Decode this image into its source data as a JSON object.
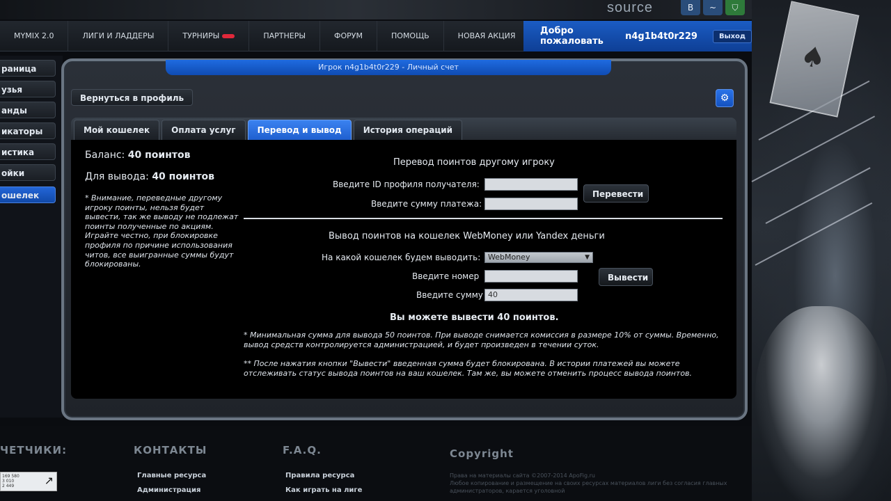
{
  "brand": {
    "text": "source",
    "social": [
      "vk",
      "twitter",
      "shield"
    ]
  },
  "navbar": {
    "items": [
      "MYMIX 2.0",
      "ЛИГИ И ЛАДДЕРЫ",
      "ТУРНИРЫ",
      "ПАРТНЕРЫ",
      "ФОРУМ",
      "ПОМОЩЬ",
      "НОВАЯ АКЦИЯ"
    ],
    "welcome": "Добро пожаловать",
    "username": "n4g1b4t0r229",
    "logout": "Выход"
  },
  "sidebar": {
    "items": [
      "раница",
      "узья",
      "анды",
      "икаторы",
      "истика",
      "ойки",
      "ошелек"
    ],
    "active_index": 6
  },
  "panel": {
    "title": "Игрок n4g1b4t0r229 - Личный счет",
    "back_label": "Вернуться в профиль",
    "gear_icon": "gear-icon",
    "tabs": [
      "Мой кошелек",
      "Оплата услуг",
      "Перевод и вывод",
      "История операций"
    ],
    "active_tab": 2
  },
  "balance": {
    "balance_label": "Баланс:",
    "balance_value": "40 поинтов",
    "withdraw_label": "Для вывода:",
    "withdraw_value": "40 поинтов",
    "note": "* Внимание, переведные другому игроку поинты, нельзя будет вывести, так же выводу не подлежат поинты полученные по акциям.\nИграйте честно, при блокировке профиля по причине использования читов, все выигранные суммы будут блокированы."
  },
  "transfer": {
    "heading": "Перевод поинтов другому игроку",
    "recipient_label": "Введите ID профиля получателя:",
    "recipient_value": "",
    "amount_label": "Введите сумму платежа:",
    "amount_value": "",
    "button": "Перевести"
  },
  "withdraw": {
    "heading": "Вывод поинтов на кошелек WebMoney или Yandex деньги",
    "wallet_label": "На какой кошелек будем выводить:",
    "wallet_selected": "WebMoney",
    "number_label": "Введите номер",
    "number_value": "",
    "sum_label": "Введите сумму",
    "sum_value": "40",
    "button": "Вывести",
    "available": "Вы можете вывести 40 поинтов.",
    "footnote1": "* Минимальная сумма для вывода 50 поинтов. При выводе снимается комиссия в размере 10% от суммы. Временно, вывод средств контролируется администрацией, и будет произведен в течении суток.",
    "footnote2": "** После нажатия кнопки \"Вывести\" введенная сумма будет блокирована. В истории платежей вы можете отслеживать статус вывода поинтов на ваш кошелек. Там же, вы можете отменить процесс вывода поинтов."
  },
  "footer": {
    "counters_heading": "ЧЕТЧИКИ:",
    "contacts_heading": "КОНТАКТЫ",
    "faq_heading": "F.A.Q.",
    "copyright_heading": "Copyright",
    "contacts_links": [
      "Главные ресурса",
      "Администрация"
    ],
    "faq_links": [
      "Правила ресурса",
      "Как играть на лиге"
    ],
    "copyright_text": "Права на материалы сайта ©2007-2014 ApoFig.ru\nЛюбое копирование и размещение на своих ресурсах материалов лиги без согласия главных администраторов, карается уголовной",
    "counter_lines": [
      "169 580",
      "3 010",
      "2 449"
    ]
  }
}
